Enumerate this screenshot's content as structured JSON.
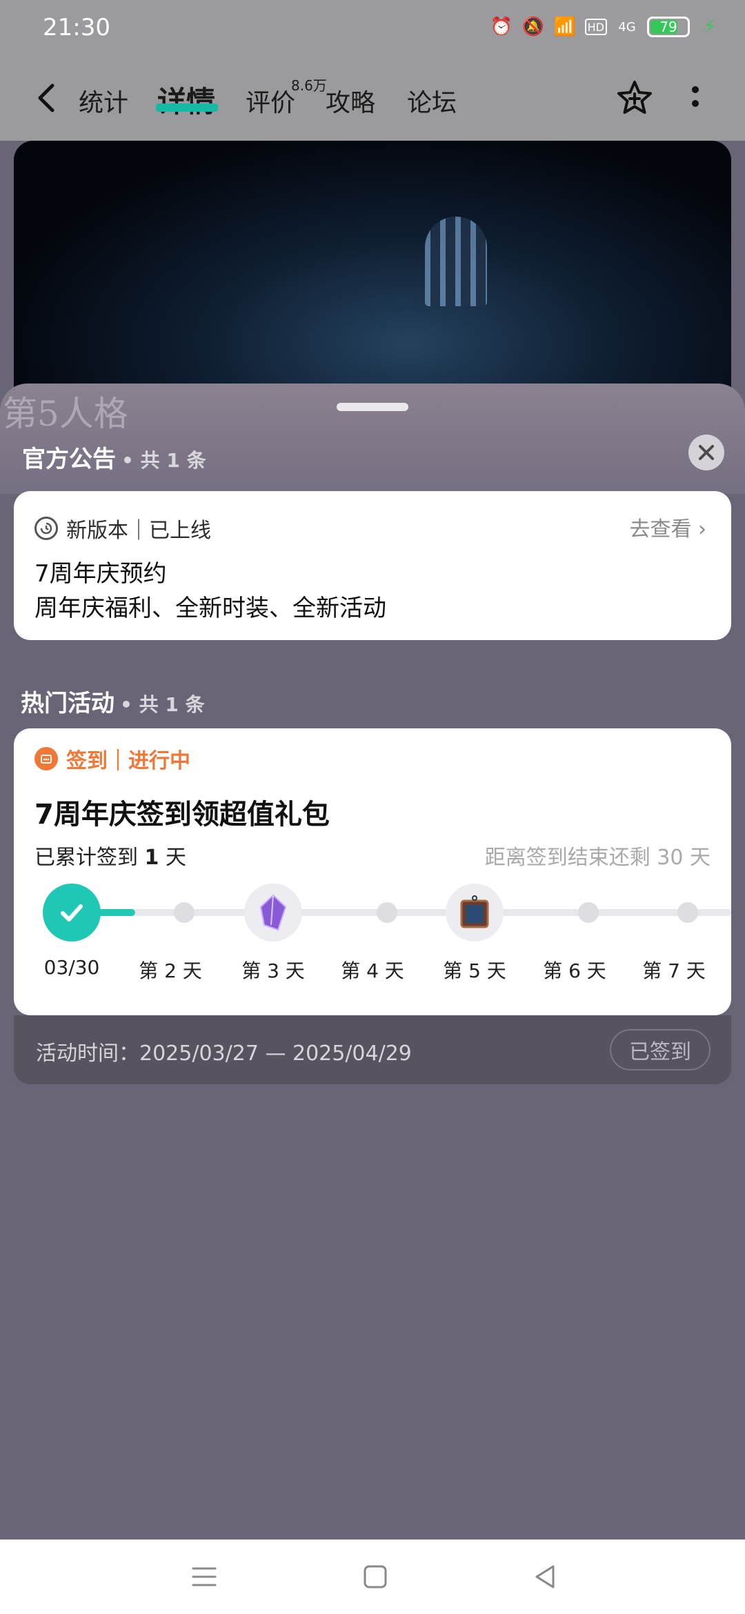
{
  "status": {
    "time": "21:30",
    "battery": "79",
    "network": "4G",
    "hd": "HD"
  },
  "nav": {
    "tabs": [
      "统计",
      "详情",
      "评价",
      "攻略",
      "论坛"
    ],
    "active_tab": "详情",
    "review_count": "8.6万"
  },
  "hero": {
    "logo_text": "第5人格"
  },
  "announcement": {
    "title": "官方公告",
    "count": "• 共 1 条",
    "tag": "新版本｜已上线",
    "link": "去查看",
    "line1": "7周年庆预约",
    "line2": "周年庆福利、全新时装、全新活动"
  },
  "activity": {
    "section_title": "热门活动",
    "count": "• 共 1 条",
    "tag": "签到｜进行中",
    "title": "7周年庆签到领超值礼包",
    "progress_prefix": "已累计签到 ",
    "progress_days": "1",
    "progress_suffix": " 天",
    "remaining": "距离签到结束还剩 30 天",
    "days": [
      "03/30",
      "第 2 天",
      "第 3 天",
      "第 4 天",
      "第 5 天",
      "第 6 天",
      "第 7 天"
    ],
    "time_label": "活动时间：2025/03/27 — 2025/04/29",
    "signed_button": "已签到",
    "accent_color": "#f07736",
    "done_color": "#1fc8b4"
  }
}
